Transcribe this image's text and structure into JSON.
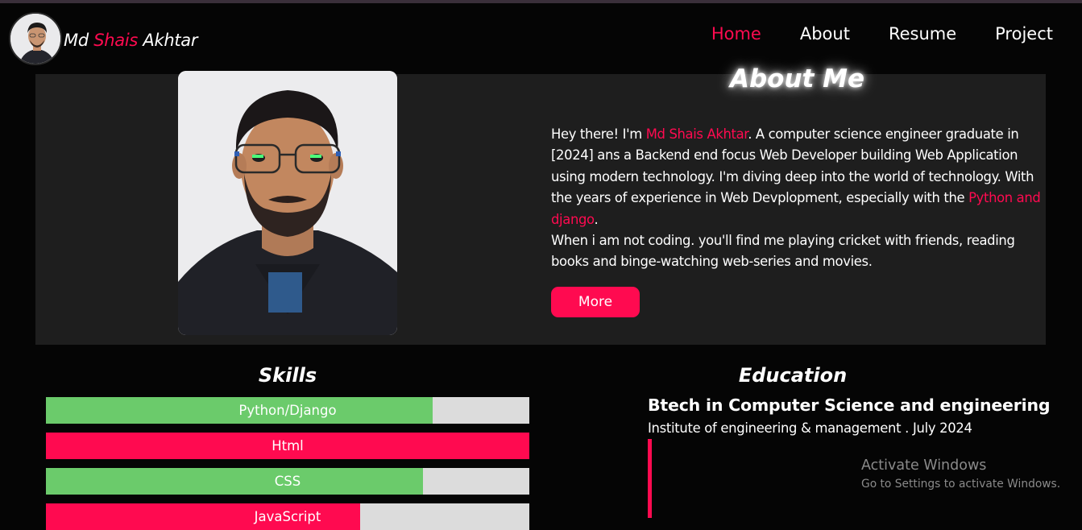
{
  "header": {
    "name_first": "Md ",
    "name_accent": "Shais",
    "name_last": " Akhtar",
    "nav": [
      {
        "label": "Home",
        "active": true
      },
      {
        "label": "About",
        "active": false
      },
      {
        "label": "Resume",
        "active": false
      },
      {
        "label": "Project",
        "active": false
      }
    ]
  },
  "about": {
    "title": "About Me",
    "text_intro": "Hey there! I'm ",
    "text_name": "Md Shais Akhtar",
    "text_body": ". A computer science engineer graduate in [2024] ans a Backend end focus Web Developer building Web Application using modern technology. I'm diving deep into the world of technology. With the years of experience in Web Devplopment, especially with the ",
    "text_tech": "Python and django",
    "text_end": ".",
    "text_hobbies": "When i am not coding. you'll find me playing cricket with friends, reading books and binge-watching web-series and movies.",
    "more_label": "More"
  },
  "skills": {
    "title": "Skills",
    "items": [
      {
        "label": "Python/Django",
        "level": 0.8,
        "color": "#6bcb6b"
      },
      {
        "label": "Html",
        "level": 1.0,
        "color": "#ff0a50"
      },
      {
        "label": "CSS",
        "level": 0.78,
        "color": "#6bcb6b"
      },
      {
        "label": "JavaScript",
        "level": 0.65,
        "color": "#ff0a50"
      }
    ]
  },
  "education": {
    "title": "Education",
    "degree": "Btech in Computer Science and engineering",
    "institute": "Institute of engineering & management . July 2024"
  },
  "watermark": {
    "line1": "Activate Windows",
    "line2": "Go to Settings to activate Windows."
  },
  "colors": {
    "accent": "#ff0a50",
    "skill_green": "#6bcb6b",
    "skill_track": "#dcdcdc"
  }
}
